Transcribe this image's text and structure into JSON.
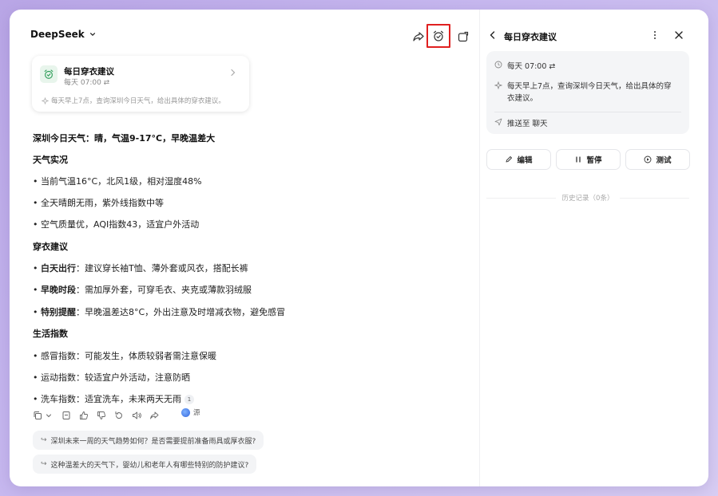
{
  "header": {
    "model_name": "DeepSeek"
  },
  "task_card": {
    "title": "每日穿衣建议",
    "schedule": "每天 07:00 ⇄",
    "description": "每天早上7点，查询深圳今日天气，给出具体的穿衣建议。"
  },
  "message": {
    "headline": "深圳今日天气：晴，气温9-17°C，早晚温差大",
    "section1_title": "天气实况",
    "weather": [
      "• 当前气温16°C，北风1级，相对湿度48%",
      "• 全天晴朗无雨，紫外线指数中等",
      "• 空气质量优，AQI指数43，适宜户外活动"
    ],
    "section2_title": "穿衣建议",
    "clothing": [
      {
        "key": "白天出行",
        "text": "：建议穿长袖T恤、薄外套或风衣，搭配长裤"
      },
      {
        "key": "早晚时段",
        "text": "：需加厚外套，可穿毛衣、夹克或薄款羽绒服"
      },
      {
        "key": "特别提醒",
        "text": "：早晚温差达8°C，外出注意及时增减衣物，避免感冒"
      }
    ],
    "section3_title": "生活指数",
    "life": [
      "• 感冒指数：可能发生，体质较弱者需注意保暖",
      "• 运动指数：较适宜户外活动，注意防晒",
      "• 洗车指数：适宜洗车，未来两天无雨"
    ],
    "citation": "1",
    "source_label": "源"
  },
  "suggestions": [
    "深圳未来一周的天气趋势如何？是否需要提前准备雨具或厚衣服?",
    "这种温差大的天气下，婴幼儿和老年人有哪些特别的防护建议?"
  ],
  "panel": {
    "title": "每日穿衣建议",
    "schedule": "每天 07:00 ⇄",
    "prompt_line1": "每天早上7点，查询深圳今日天气，给出具体的穿",
    "prompt_line2": "衣建议。",
    "push_to": "推送至 聊天",
    "edit_label": "编辑",
    "pause_label": "暂停",
    "test_label": "测试",
    "history_label": "历史记录（0条）"
  },
  "colors": {
    "highlight_box": "#e02020",
    "task_icon_green": "#2f9e5a",
    "task_icon_bg": "#e8f5ec"
  }
}
